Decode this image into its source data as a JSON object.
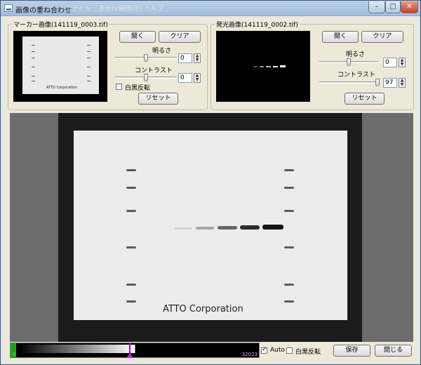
{
  "window": {
    "title": "画像の重ね合わせ",
    "ghost_menu": [
      "ファイル",
      "表示(V)",
      "編集(E)",
      "ヘルプ"
    ],
    "minimize_symbol": "–",
    "maximize_symbol": "□",
    "close_symbol": "✕"
  },
  "marker_panel": {
    "title": "マーカー画像(141119_0003.tif)",
    "open_label": "開く",
    "clear_label": "クリア",
    "brightness_label": "明るさ",
    "brightness_value": "0",
    "contrast_label": "コントラスト",
    "contrast_value": "0",
    "invert_label": "白黒反転",
    "invert_checked": false,
    "reset_label": "リセット",
    "thumbnail_text": "ATTO Corporation"
  },
  "luminescence_panel": {
    "title": "発光画像(141119_0002.tif)",
    "open_label": "開く",
    "clear_label": "クリア",
    "brightness_label": "明るさ",
    "brightness_value": "0",
    "contrast_label": "コントラスト",
    "contrast_value": "97",
    "reset_label": "リセット"
  },
  "main_view": {
    "overlay_text": "ATTO Corporation"
  },
  "bottom": {
    "lut_min": "0",
    "lut_max": "32023",
    "auto_label": "Auto",
    "auto_checked": true,
    "invert_label": "白黒反転",
    "invert_checked": false,
    "save_label": "保存",
    "close_label": "閉じる"
  },
  "icons": [
    "app-window-icon",
    "spin-up-icon",
    "spin-down-icon"
  ],
  "colors": {
    "lut_cursor": "#b000c8",
    "lut_min_marker": "#1aa31a",
    "close_button": "#c8402a"
  }
}
